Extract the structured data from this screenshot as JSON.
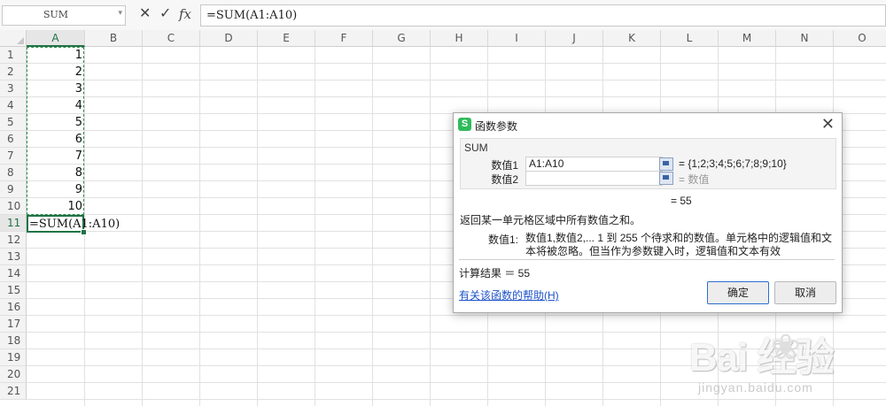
{
  "formula_bar": {
    "name_box": "SUM",
    "cancel_icon": "✕",
    "confirm_icon": "✓",
    "fx_label": "fx",
    "formula": "=SUM(A1:A10)"
  },
  "sheet": {
    "columns": [
      "A",
      "B",
      "C",
      "D",
      "E",
      "F",
      "G",
      "H",
      "I",
      "J",
      "K",
      "L",
      "M",
      "N",
      "O"
    ],
    "rows": [
      "1",
      "2",
      "3",
      "4",
      "5",
      "6",
      "7",
      "8",
      "9",
      "10",
      "11",
      "12",
      "13",
      "14",
      "15",
      "16",
      "17",
      "18",
      "19",
      "20",
      "21"
    ],
    "column_a_values": [
      "1",
      "2",
      "3",
      "4",
      "5",
      "6",
      "7",
      "8",
      "9",
      "10"
    ],
    "active_cell_text": "=SUM(A1:A10)"
  },
  "dialog": {
    "logo": "S",
    "title": "函数参数",
    "close_icon": "✕",
    "function_name": "SUM",
    "arg1_label": "数值1",
    "arg1_value": "A1:A10",
    "arg1_result": "= {1;2;3;4;5;6;7;8;9;10}",
    "arg2_label": "数值2",
    "arg2_value": "",
    "arg2_result": "= 数值",
    "result_line": "= 55",
    "description": "返回某一单元格区域中所有数值之和。",
    "param_label": "数值1:",
    "param_text": "数值1,数值2,... 1 到 255 个待求和的数值。单元格中的逻辑值和文本将被忽略。但当作为参数键入时，逻辑值和文本有效",
    "calc_result": "计算结果 ＝ 55",
    "help_link": "有关该函数的帮助(H)",
    "ok_label": "确定",
    "cancel_label": "取消"
  },
  "watermark": {
    "brand": "Bai  经验",
    "url": "jingyan.baidu.com"
  }
}
